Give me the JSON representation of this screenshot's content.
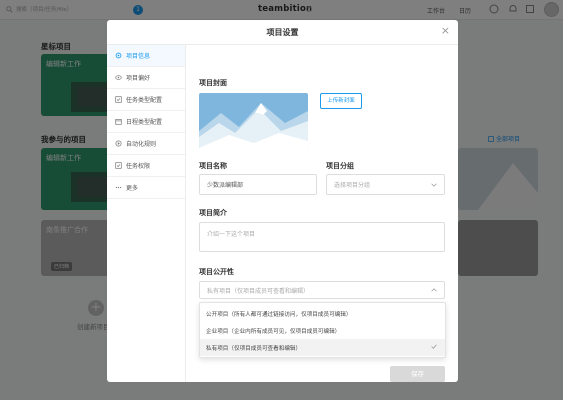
{
  "app": {
    "brand": "teambition",
    "search_placeholder": "搜索（项目/任务/file）",
    "notification_count": "1",
    "top_links": [
      "工作台",
      "日历"
    ],
    "sections": {
      "starred": "星标项目",
      "joined": "我参与的项目"
    },
    "cards": {
      "starred_1": "编辑新工作",
      "joined_1": "编辑新工作",
      "joined_2": "南条推广合作"
    },
    "card_tag": "已归档",
    "side_link": "全部项目",
    "create_label": "创建新项目"
  },
  "modal": {
    "title": "项目设置",
    "close_glyph": "×",
    "nav": [
      {
        "label": "项目信息",
        "icon": "gear-icon"
      },
      {
        "label": "项目偏好",
        "icon": "eye-icon"
      },
      {
        "label": "任务类型配置",
        "icon": "checkbox-icon"
      },
      {
        "label": "日程类型配置",
        "icon": "calendar-icon"
      },
      {
        "label": "自动化规则",
        "icon": "automation-icon"
      },
      {
        "label": "任务权限",
        "icon": "checkbox-icon"
      },
      {
        "label": "更多",
        "icon": "more-icon"
      }
    ],
    "cover_label": "项目封面",
    "upload_button": "上传新封面",
    "name_label": "项目名称",
    "name_value": "少数派编辑部",
    "group_label": "项目分组",
    "group_placeholder": "选择项目分组",
    "intro_label": "项目简介",
    "intro_placeholder": "介绍一下这个项目",
    "visibility_label": "项目公开性",
    "visibility_value": "私有项目（仅项目成员可查看和编辑）",
    "visibility_options": [
      "公开项目（所有人都可通过链接访问，仅项目成员可编辑）",
      "企业项目（企业内所有成员可见，仅项目成员可编辑）",
      "私有项目（仅项目成员可查看和编辑）"
    ],
    "selected_option_index": 2,
    "save_button": "保存"
  },
  "colors": {
    "accent": "#1b9aee",
    "card_green": "#2e9a6e",
    "overlay": "rgba(0,0,0,0.5)"
  }
}
